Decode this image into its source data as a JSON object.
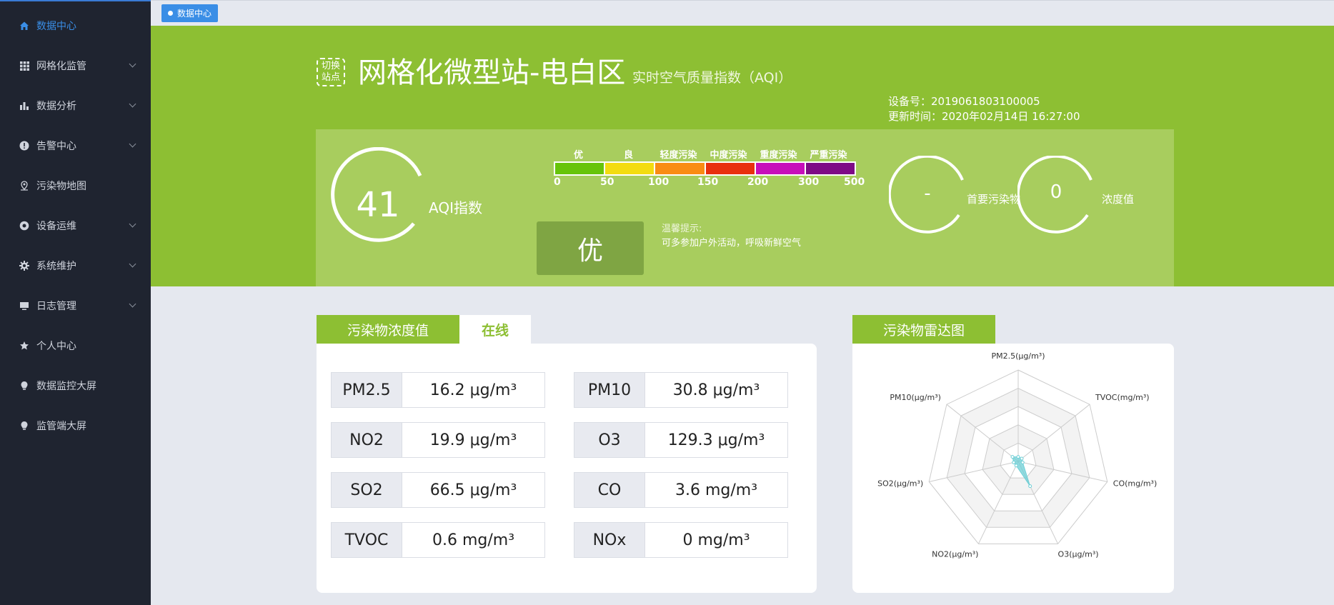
{
  "sidebar": {
    "items": [
      {
        "label": "数据中心",
        "icon": "home-icon",
        "active": true,
        "has_children": false
      },
      {
        "label": "网格化监管",
        "icon": "grid-icon",
        "active": false,
        "has_children": true
      },
      {
        "label": "数据分析",
        "icon": "bar-chart-icon",
        "active": false,
        "has_children": true
      },
      {
        "label": "告警中心",
        "icon": "alert-icon",
        "active": false,
        "has_children": true
      },
      {
        "label": "污染物地图",
        "icon": "map-pin-icon",
        "active": false,
        "has_children": false
      },
      {
        "label": "设备运维",
        "icon": "settings-circle-icon",
        "active": false,
        "has_children": true
      },
      {
        "label": "系统维护",
        "icon": "gear-icon",
        "active": false,
        "has_children": true
      },
      {
        "label": "日志管理",
        "icon": "monitor-icon",
        "active": false,
        "has_children": true
      },
      {
        "label": "个人中心",
        "icon": "star-icon",
        "active": false,
        "has_children": false
      },
      {
        "label": "数据监控大屏",
        "icon": "bulb-icon",
        "active": false,
        "has_children": false
      },
      {
        "label": "监管端大屏",
        "icon": "bulb-icon",
        "active": false,
        "has_children": false
      }
    ]
  },
  "tagbar": {
    "active_tag": "数据中心"
  },
  "header": {
    "switch_label": "切换站点",
    "switch_line1": "切换",
    "switch_line2": "站点",
    "station_name": "网格化微型站-电白区",
    "subtitle": "实时空气质量指数（AQI）",
    "device_no": "设备号：2019061803100005",
    "update_time": "更新时间：2020年02月14日 16:27:00"
  },
  "aqi": {
    "value": "41",
    "label": "AQI指数",
    "level": "优",
    "tip_title": "温馨提示:",
    "tip_text": "可多参加户外活动，呼吸新鲜空气",
    "primary_pollutant_value": "-",
    "primary_pollutant_label": "首要污染物",
    "concentration_value": "0",
    "concentration_label": "浓度值",
    "scale": {
      "levels": [
        "优",
        "良",
        "轻度污染",
        "中度污染",
        "重度污染",
        "严重污染"
      ],
      "colors": [
        "#67c40a",
        "#f3dc10",
        "#f98c14",
        "#e8300e",
        "#c70eba",
        "#7e0a86"
      ],
      "breakpoints": [
        "0",
        "50",
        "100",
        "150",
        "200",
        "300",
        "500"
      ]
    }
  },
  "concentration_card": {
    "tab_title": "污染物浓度值",
    "tab_status": "在线",
    "rows": [
      {
        "k1": "PM2.5",
        "v1": "16.2 μg/m³",
        "k2": "PM10",
        "v2": "30.8 μg/m³"
      },
      {
        "k1": "NO2",
        "v1": "19.9 μg/m³",
        "k2": "O3",
        "v2": "129.3 μg/m³"
      },
      {
        "k1": "SO2",
        "v1": "66.5 μg/m³",
        "k2": "CO",
        "v2": "3.6 mg/m³"
      },
      {
        "k1": "TVOC",
        "v1": "0.6 mg/m³",
        "k2": "NOx",
        "v2": "0 mg/m³"
      }
    ]
  },
  "radar_card": {
    "tab_title": "污染物雷达图"
  },
  "chart_data": {
    "type": "radar",
    "axes": [
      "PM2.5(μg/m³)",
      "TVOC(mg/m³)",
      "CO(mg/m³)",
      "O3(μg/m³)",
      "NO2(μg/m³)",
      "SO2(μg/m³)",
      "PM10(μg/m³)"
    ],
    "values": [
      0.05,
      0.05,
      0.05,
      0.3,
      0.05,
      0.05,
      0.08
    ],
    "rings": 5,
    "fill_color": "#6dcfd6"
  }
}
